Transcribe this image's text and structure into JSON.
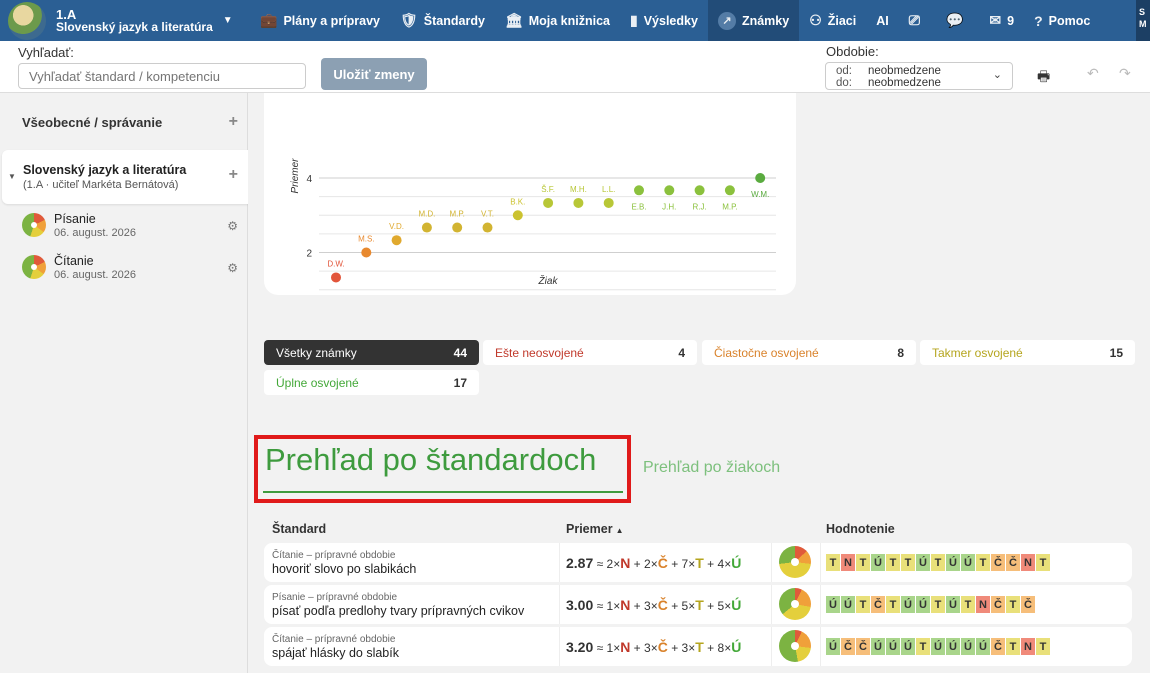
{
  "header": {
    "class_name": "1.A",
    "subject": "Slovenský jazyk a literatúra",
    "nav": [
      {
        "label": "Plány a prípravy",
        "icon": "briefcase-icon"
      },
      {
        "label": "Štandardy",
        "icon": "shield-check-icon"
      },
      {
        "label": "Moja knižnica",
        "icon": "library-icon"
      },
      {
        "label": "Výsledky",
        "icon": "bar-chart-icon"
      },
      {
        "label": "Známky",
        "icon": "grades-icon"
      },
      {
        "label": "Žiaci",
        "icon": "students-icon"
      },
      {
        "label": "AI",
        "icon": ""
      },
      {
        "label": "",
        "icon": "cast-icon"
      },
      {
        "label": "",
        "icon": "chat-icon"
      },
      {
        "label": "9",
        "icon": "mail-icon"
      },
      {
        "label": "Pomoc",
        "icon": "help-icon"
      }
    ],
    "user_initials": "S\nM"
  },
  "toolbar": {
    "search_label": "Vyhľadať:",
    "search_placeholder": "Vyhľadať štandard / kompetenciu",
    "save_label": "Uložiť zmeny",
    "period_label": "Obdobie:",
    "period_from_key": "od:",
    "period_from": "neobmedzene",
    "period_to_key": "do:",
    "period_to": "neobmedzene"
  },
  "sidebar": {
    "general_label": "Všeobecné / správanie",
    "subject_title": "Slovenský jazyk a literatúra",
    "subject_sub": "(1.A · učiteľ Markéta Bernátová)",
    "items": [
      {
        "name": "Písanie",
        "date": "06. august. 2026"
      },
      {
        "name": "Čítanie",
        "date": "06. august. 2026"
      }
    ]
  },
  "chart_data": {
    "type": "scatter",
    "xlabel": "Žiak",
    "ylabel": "Priemer",
    "ylim": [
      0,
      4
    ],
    "yticks": [
      0,
      2,
      4
    ],
    "points": [
      {
        "label": "D.W.",
        "y": 1.33,
        "color": "#e2553a"
      },
      {
        "label": "M.S.",
        "y": 2.0,
        "color": "#e8892e"
      },
      {
        "label": "V.D.",
        "y": 2.33,
        "color": "#e0a92e"
      },
      {
        "label": "M.D.",
        "y": 2.67,
        "color": "#d2b431"
      },
      {
        "label": "M.P.",
        "y": 2.67,
        "color": "#d2b431"
      },
      {
        "label": "V.T.",
        "y": 2.67,
        "color": "#d2b431"
      },
      {
        "label": "B.K.",
        "y": 3.0,
        "color": "#cbc22f"
      },
      {
        "label": "Š.F.",
        "y": 3.33,
        "color": "#b8c737"
      },
      {
        "label": "M.H.",
        "y": 3.33,
        "color": "#b8c737"
      },
      {
        "label": "L.L.",
        "y": 3.33,
        "color": "#b8c737"
      },
      {
        "label": "E.B.",
        "y": 3.67,
        "color": "#8bc13d"
      },
      {
        "label": "J.H.",
        "y": 3.67,
        "color": "#8bc13d"
      },
      {
        "label": "R.J.",
        "y": 3.67,
        "color": "#8bc13d"
      },
      {
        "label": "M.P.",
        "y": 3.67,
        "color": "#8bc13d"
      },
      {
        "label": "W.M.",
        "y": 4.0,
        "color": "#5aab3f"
      }
    ]
  },
  "filters": [
    {
      "label": "Všetky známky",
      "count": "44",
      "tone": "active"
    },
    {
      "label": "Ešte neosvojené",
      "count": "4",
      "tone": "red"
    },
    {
      "label": "Čiastočne osvojené",
      "count": "8",
      "tone": "orange"
    },
    {
      "label": "Takmer osvojené",
      "count": "15",
      "tone": "yellow"
    },
    {
      "label": "Úplne osvojené",
      "count": "17",
      "tone": "green"
    }
  ],
  "overview": {
    "title": "Prehľad po štandardoch",
    "alt_title": "Prehľad po žiakoch",
    "col_standard": "Štandard",
    "col_avg": "Priemer",
    "col_eval": "Hodnotenie"
  },
  "rows": [
    {
      "meta": "Čítanie – prípravné obdobie",
      "name": "hovoriť slovo po slabikách",
      "avg": "2.87",
      "n": "2",
      "c": "2",
      "t": "7",
      "u": "4",
      "grades": [
        "T",
        "N",
        "T",
        "Ú",
        "T",
        "T",
        "Ú",
        "T",
        "Ú",
        "Ú",
        "T",
        "Č",
        "Č",
        "N",
        "T"
      ]
    },
    {
      "meta": "Písanie – prípravné obdobie",
      "name": "písať podľa predlohy tvary prípravných cvikov",
      "avg": "3.00",
      "n": "1",
      "c": "3",
      "t": "5",
      "u": "5",
      "grades": [
        "Ú",
        "Ú",
        "T",
        "Č",
        "T",
        "Ú",
        "Ú",
        "T",
        "Ú",
        "T",
        "N",
        "Č",
        "T",
        "Č"
      ]
    },
    {
      "meta": "Čítanie – prípravné obdobie",
      "name": "spájať hlásky do slabík",
      "avg": "3.20",
      "n": "1",
      "c": "3",
      "t": "3",
      "u": "8",
      "grades": [
        "Ú",
        "Č",
        "Č",
        "Ú",
        "Ú",
        "Ú",
        "T",
        "Ú",
        "Ú",
        "Ú",
        "Ú",
        "Č",
        "T",
        "N",
        "T"
      ]
    }
  ]
}
